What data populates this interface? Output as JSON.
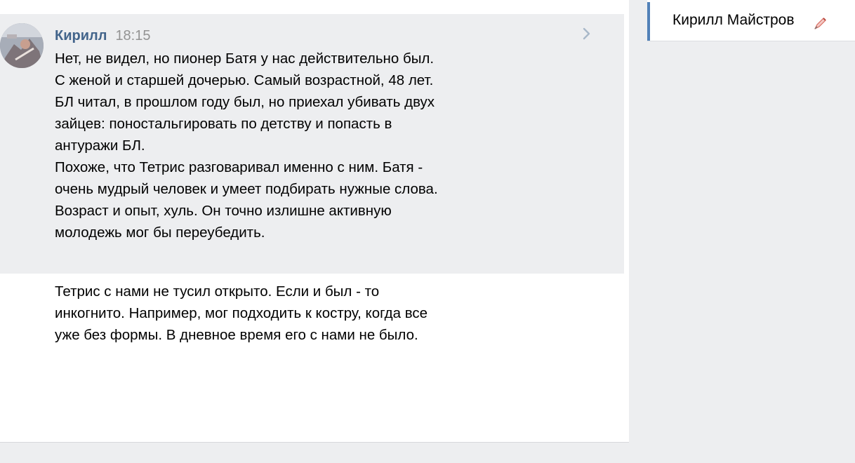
{
  "conversation": {
    "message_group": {
      "author": "Кирилл",
      "time": "18:15",
      "messages": [
        {
          "text": "Нет, не видел, но пионер Батя у нас действительно был. С женой и старшей дочерью. Самый возрастной, 48 лет. БЛ читал, в прошлом году был, но приехал убивать двух зайцев: поностальгировать по детству и попасть в антуражи БЛ.\nПохоже, что Тетрис разговаривал именно с ним. Батя - очень мудрый человек и умеет подбирать нужные слова. Возраст и опыт, хуль. Он точно излишне активную молодежь мог бы переубедить."
        },
        {
          "text": "Тетрис с нами не тусил открыто. Если и был - то инкогнито. Например, мог подходить к костру, когда все уже без формы. В дневное время его с нами не было."
        }
      ]
    }
  },
  "right_panel": {
    "contact_name": "Кирилл Майстров",
    "status_icon": "pencil-icon"
  },
  "colors": {
    "author": "#42648b",
    "time": "#939393",
    "accent": "#5181b8",
    "highlight": "#edeef0"
  }
}
